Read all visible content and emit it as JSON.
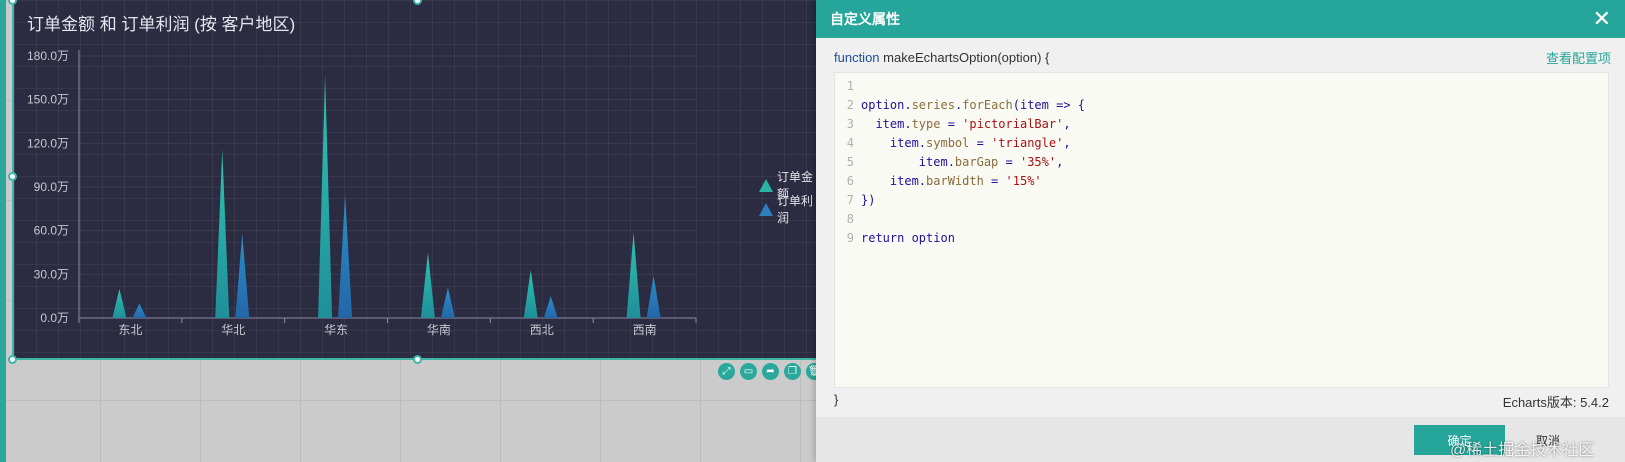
{
  "chart": {
    "title": "订单金额 和 订单利润 (按 客户地区)",
    "legend": [
      {
        "name": "订单金额",
        "color": "#2ab3a6"
      },
      {
        "name": "订单利润",
        "color": "#2f7fc0"
      }
    ]
  },
  "chart_data": {
    "type": "bar",
    "title": "订单金额 和 订单利润 (按 客户地区)",
    "categories": [
      "东北",
      "华北",
      "华东",
      "华南",
      "西北",
      "西南"
    ],
    "series": [
      {
        "name": "订单金额",
        "values": [
          200000,
          1160000,
          1670000,
          450000,
          330000,
          590000
        ]
      },
      {
        "name": "订单利润",
        "values": [
          100000,
          580000,
          850000,
          210000,
          150000,
          290000
        ]
      }
    ],
    "yticks": [
      "0.0万",
      "30.0万",
      "60.0万",
      "90.0万",
      "120.0万",
      "150.0万",
      "180.0万"
    ],
    "ylim": [
      0,
      1800000
    ],
    "legend_position": "right",
    "grid": true
  },
  "widget_tools": [
    "expand-icon",
    "comment-icon",
    "share-icon",
    "copy-icon",
    "delete-icon"
  ],
  "dialog": {
    "title": "自定义属性",
    "close_glyph": "✕",
    "func_keyword": "function",
    "func_signature": " makeEchartsOption(option) {",
    "view_config": "查看配置项",
    "closing_brace": "}",
    "version": "Echarts版本: 5.4.2",
    "ok_label": "确定",
    "cancel_label": "取消"
  },
  "code_lines": [
    {
      "n": "1",
      "text": ""
    },
    {
      "n": "2",
      "text": "option.series.forEach(item => {"
    },
    {
      "n": "3",
      "text": "  item.type = 'pictorialBar',"
    },
    {
      "n": "4",
      "text": "    item.symbol = 'triangle',"
    },
    {
      "n": "5",
      "text": "        item.barGap = '35%',"
    },
    {
      "n": "6",
      "text": "    item.barWidth = '15%'"
    },
    {
      "n": "7",
      "text": "})"
    },
    {
      "n": "8",
      "text": ""
    },
    {
      "n": "9",
      "text": "return option"
    }
  ],
  "watermark": "@稀土掘金技术社区"
}
